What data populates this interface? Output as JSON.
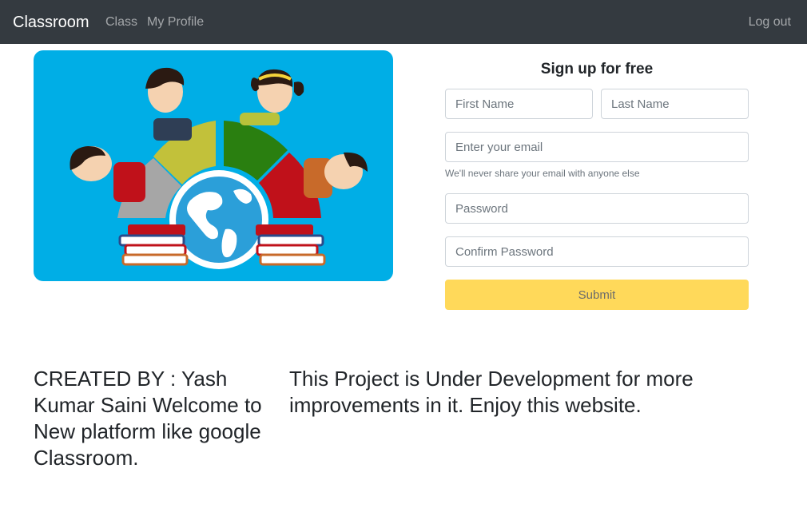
{
  "navbar": {
    "brand": "Classroom",
    "links": [
      "Class",
      "My Profile"
    ],
    "logout": "Log out"
  },
  "hero": {
    "illustration": "classroom-globe-illustration",
    "background": "#00aee6"
  },
  "signup": {
    "title": "Sign up for free",
    "first_name_placeholder": "First Name",
    "last_name_placeholder": "Last Name",
    "email_placeholder": "Enter your email",
    "email_help": "We'll never share your email with anyone else",
    "password_placeholder": "Password",
    "confirm_password_placeholder": "Confirm Password",
    "submit_label": "Submit",
    "submit_color": "#ffd95a"
  },
  "footer": {
    "left_text": "CREATED BY : Yash Kumar Saini Welcome to New platform like google Classroom.",
    "right_text": "This Project is Under Development for more improvements in it. Enjoy this website."
  }
}
